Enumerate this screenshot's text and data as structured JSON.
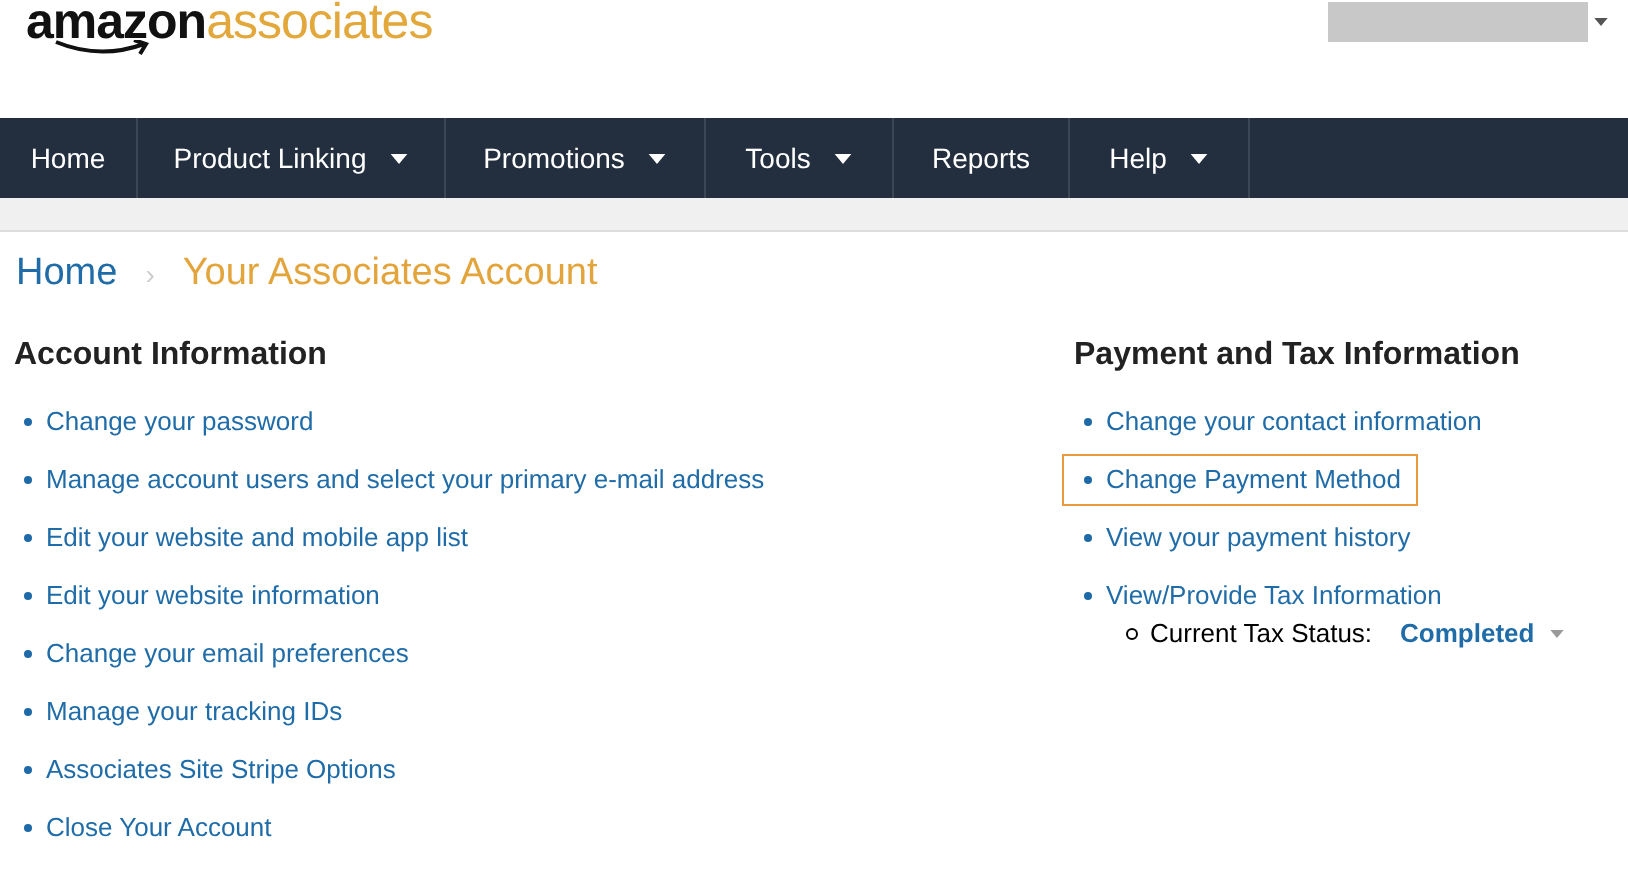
{
  "logo": {
    "brand": "amazon",
    "product": "associates"
  },
  "account_menu": {
    "has_dropdown": true
  },
  "nav": [
    {
      "label": "Home",
      "dropdown": false
    },
    {
      "label": "Product Linking",
      "dropdown": true
    },
    {
      "label": "Promotions",
      "dropdown": true
    },
    {
      "label": "Tools",
      "dropdown": true
    },
    {
      "label": "Reports",
      "dropdown": false
    },
    {
      "label": "Help",
      "dropdown": true
    }
  ],
  "breadcrumb": {
    "home": "Home",
    "separator": "›",
    "current": "Your Associates Account"
  },
  "sections": [
    {
      "title": "Account Information",
      "links": [
        {
          "label": "Change your password",
          "highlighted": false
        },
        {
          "label": "Manage account users and select your primary e-mail address",
          "highlighted": false
        },
        {
          "label": "Edit your website and mobile app list",
          "highlighted": false
        },
        {
          "label": "Edit your website information",
          "highlighted": false
        },
        {
          "label": "Change your email preferences",
          "highlighted": false
        },
        {
          "label": "Manage your tracking IDs",
          "highlighted": false
        },
        {
          "label": "Associates Site Stripe Options",
          "highlighted": false
        },
        {
          "label": "Close Your Account",
          "highlighted": false
        }
      ]
    },
    {
      "title": "Payment and Tax Information",
      "links": [
        {
          "label": "Change your contact information",
          "highlighted": false
        },
        {
          "label": "Change Payment Method",
          "highlighted": true
        },
        {
          "label": "View your payment history",
          "highlighted": false
        },
        {
          "label": "View/Provide Tax Information",
          "highlighted": false,
          "sub": {
            "label": "Current Tax Status:",
            "value": "Completed",
            "dropdown": true
          }
        }
      ]
    }
  ]
}
